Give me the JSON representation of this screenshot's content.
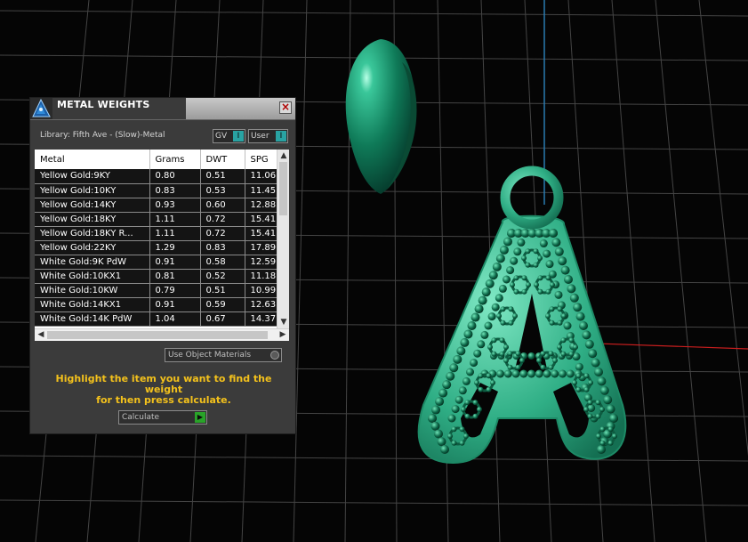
{
  "panel": {
    "title": "METAL WEIGHTS",
    "library": "Library: Fifth Ave - (Slow)-Metal",
    "gv_label": "GV",
    "user_label": "User",
    "toggle_knob": "I",
    "columns": [
      "Metal",
      "Grams",
      "DWT",
      "SPG"
    ],
    "rows": [
      [
        "Yellow Gold:9KY",
        "0.80",
        "0.51",
        "11.06"
      ],
      [
        "Yellow Gold:10KY",
        "0.83",
        "0.53",
        "11.45"
      ],
      [
        "Yellow Gold:14KY",
        "0.93",
        "0.60",
        "12.88"
      ],
      [
        "Yellow Gold:18KY",
        "1.11",
        "0.72",
        "15.41"
      ],
      [
        "Yellow Gold:18KY R...",
        "1.11",
        "0.72",
        "15.41"
      ],
      [
        "Yellow Gold:22KY",
        "1.29",
        "0.83",
        "17.89"
      ],
      [
        "White Gold:9K PdW",
        "0.91",
        "0.58",
        "12.59"
      ],
      [
        "White Gold:10KX1",
        "0.81",
        "0.52",
        "11.18"
      ],
      [
        "White Gold:10KW",
        "0.79",
        "0.51",
        "10.99"
      ],
      [
        "White Gold:14KX1",
        "0.91",
        "0.59",
        "12.63"
      ],
      [
        "White Gold:14K PdW",
        "1.04",
        "0.67",
        "14.37"
      ]
    ],
    "use_object_materials": "Use Object Materials",
    "instruction_line1": "Highlight the item you want to find the weight",
    "instruction_line2": "for then press calculate.",
    "calculate_label": "Calculate"
  },
  "colors": {
    "accent_teal": "#29a3a3",
    "instruction_yellow": "#f3c11c",
    "model_green": "#2fc495",
    "axis_red": "#c81e1e",
    "axis_blue": "#2a7bb0"
  }
}
